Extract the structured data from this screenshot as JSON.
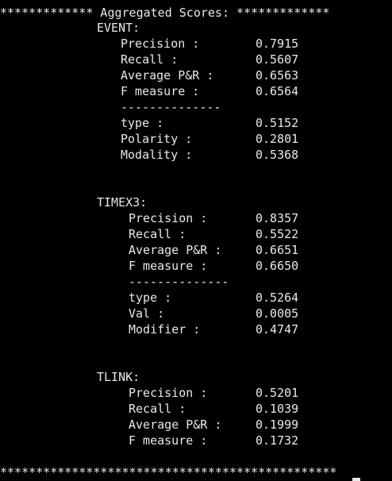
{
  "header": "************* Aggregated Scores: *************",
  "footer": "***********************************************",
  "divider": "--------------",
  "sections": [
    {
      "title": "EVENT:",
      "metrics": [
        {
          "label": "Precision :",
          "value": "0.7915"
        },
        {
          "label": "Recall :",
          "value": "0.5607"
        },
        {
          "label": "Average P&R :",
          "value": "0.6563"
        },
        {
          "label": "F measure :",
          "value": "0.6564"
        }
      ],
      "attributes": [
        {
          "label": "type :",
          "value": "0.5152"
        },
        {
          "label": "Polarity :",
          "value": "0.2801"
        },
        {
          "label": "Modality :",
          "value": "0.5368"
        }
      ]
    },
    {
      "title": "TIMEX3:",
      "metrics": [
        {
          "label": "Precision :",
          "value": "0.8357"
        },
        {
          "label": "Recall :",
          "value": "0.5522"
        },
        {
          "label": "Average P&R :",
          "value": "0.6651"
        },
        {
          "label": "F measure :",
          "value": "0.6650"
        }
      ],
      "attributes": [
        {
          "label": "type :",
          "value": "0.5264"
        },
        {
          "label": "Val :",
          "value": "0.0005"
        },
        {
          "label": "Modifier :",
          "value": "0.4747"
        }
      ]
    },
    {
      "title": "TLINK:",
      "metrics": [
        {
          "label": "Precision :",
          "value": "0.5201"
        },
        {
          "label": "Recall :",
          "value": "0.1039"
        },
        {
          "label": "Average P&R :",
          "value": "0.1999"
        },
        {
          "label": "F measure :",
          "value": "0.1732"
        }
      ]
    }
  ]
}
